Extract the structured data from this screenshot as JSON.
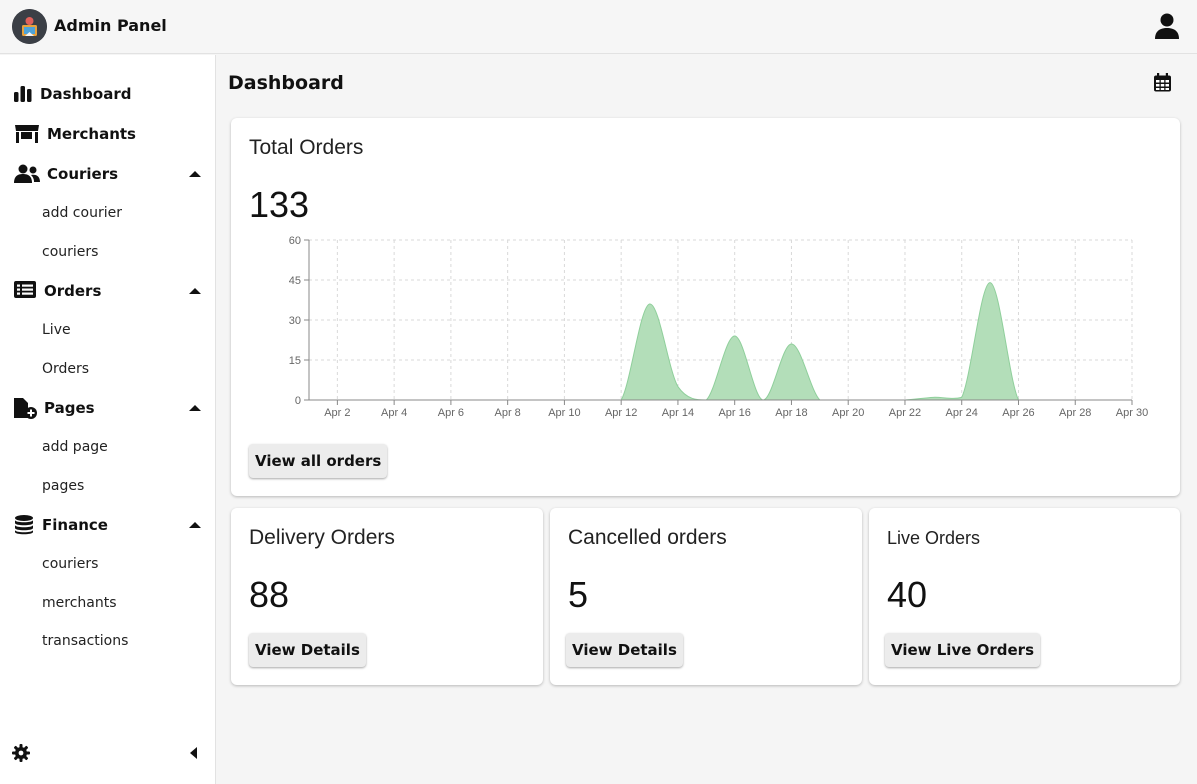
{
  "app": {
    "title": "Admin Panel",
    "brand_color": "#3b3f46"
  },
  "header": {
    "user_icon": "user-icon"
  },
  "sidebar": {
    "sections": [
      {
        "label": "Dashboard",
        "icon": "bar-chart-icon"
      },
      {
        "label": "Merchants",
        "icon": "store-icon"
      },
      {
        "label": "Couriers",
        "icon": "users-icon",
        "expanded": true,
        "items": [
          "add courier",
          "couriers"
        ]
      },
      {
        "label": "Orders",
        "icon": "list-icon",
        "expanded": true,
        "items": [
          "Live",
          "Orders"
        ]
      },
      {
        "label": "Pages",
        "icon": "file-add-icon",
        "expanded": true,
        "items": [
          "add page",
          "pages"
        ]
      },
      {
        "label": "Finance",
        "icon": "coins-icon",
        "expanded": true,
        "items": [
          "couriers",
          "merchants",
          "transactions"
        ]
      }
    ],
    "footer_icons": [
      "gear-icon",
      "collapse-left-icon"
    ]
  },
  "page": {
    "title": "Dashboard",
    "calendar_icon": "calendar-icon"
  },
  "total_orders": {
    "title": "Total Orders",
    "value": "133",
    "button": "View all orders"
  },
  "cards": [
    {
      "title": "Delivery Orders",
      "value": "88",
      "button": "View Details"
    },
    {
      "title": "Cancelled orders",
      "value": "5",
      "button": "View Details"
    },
    {
      "title": "Live Orders",
      "value": "40",
      "button": "View Live Orders"
    }
  ],
  "chart_data": {
    "type": "area",
    "color": "#b3deb9",
    "stroke_color": "#8fcf9b",
    "grid": true,
    "ylim": [
      0,
      60
    ],
    "yticks": [
      0,
      15,
      30,
      45,
      60
    ],
    "xlim": [
      1,
      30
    ],
    "xticks": [
      "Apr 2",
      "Apr 4",
      "Apr 6",
      "Apr 8",
      "Apr 10",
      "Apr 12",
      "Apr 14",
      "Apr 16",
      "Apr 18",
      "Apr 20",
      "Apr 22",
      "Apr 24",
      "Apr 26",
      "Apr 28",
      "Apr 30"
    ],
    "x": [
      "Apr 1",
      "Apr 2",
      "Apr 3",
      "Apr 4",
      "Apr 5",
      "Apr 6",
      "Apr 7",
      "Apr 8",
      "Apr 9",
      "Apr 10",
      "Apr 11",
      "Apr 12",
      "Apr 13",
      "Apr 14",
      "Apr 15",
      "Apr 16",
      "Apr 17",
      "Apr 18",
      "Apr 19",
      "Apr 20",
      "Apr 21",
      "Apr 22",
      "Apr 23",
      "Apr 24",
      "Apr 25",
      "Apr 26",
      "Apr 27",
      "Apr 28",
      "Apr 29",
      "Apr 30"
    ],
    "values": [
      0,
      0,
      0,
      0,
      0,
      0,
      0,
      0,
      0,
      0,
      0,
      0,
      36,
      5,
      0,
      24,
      0,
      21,
      0,
      0,
      0,
      0,
      1,
      1,
      44,
      0,
      0,
      0,
      0,
      0
    ]
  }
}
